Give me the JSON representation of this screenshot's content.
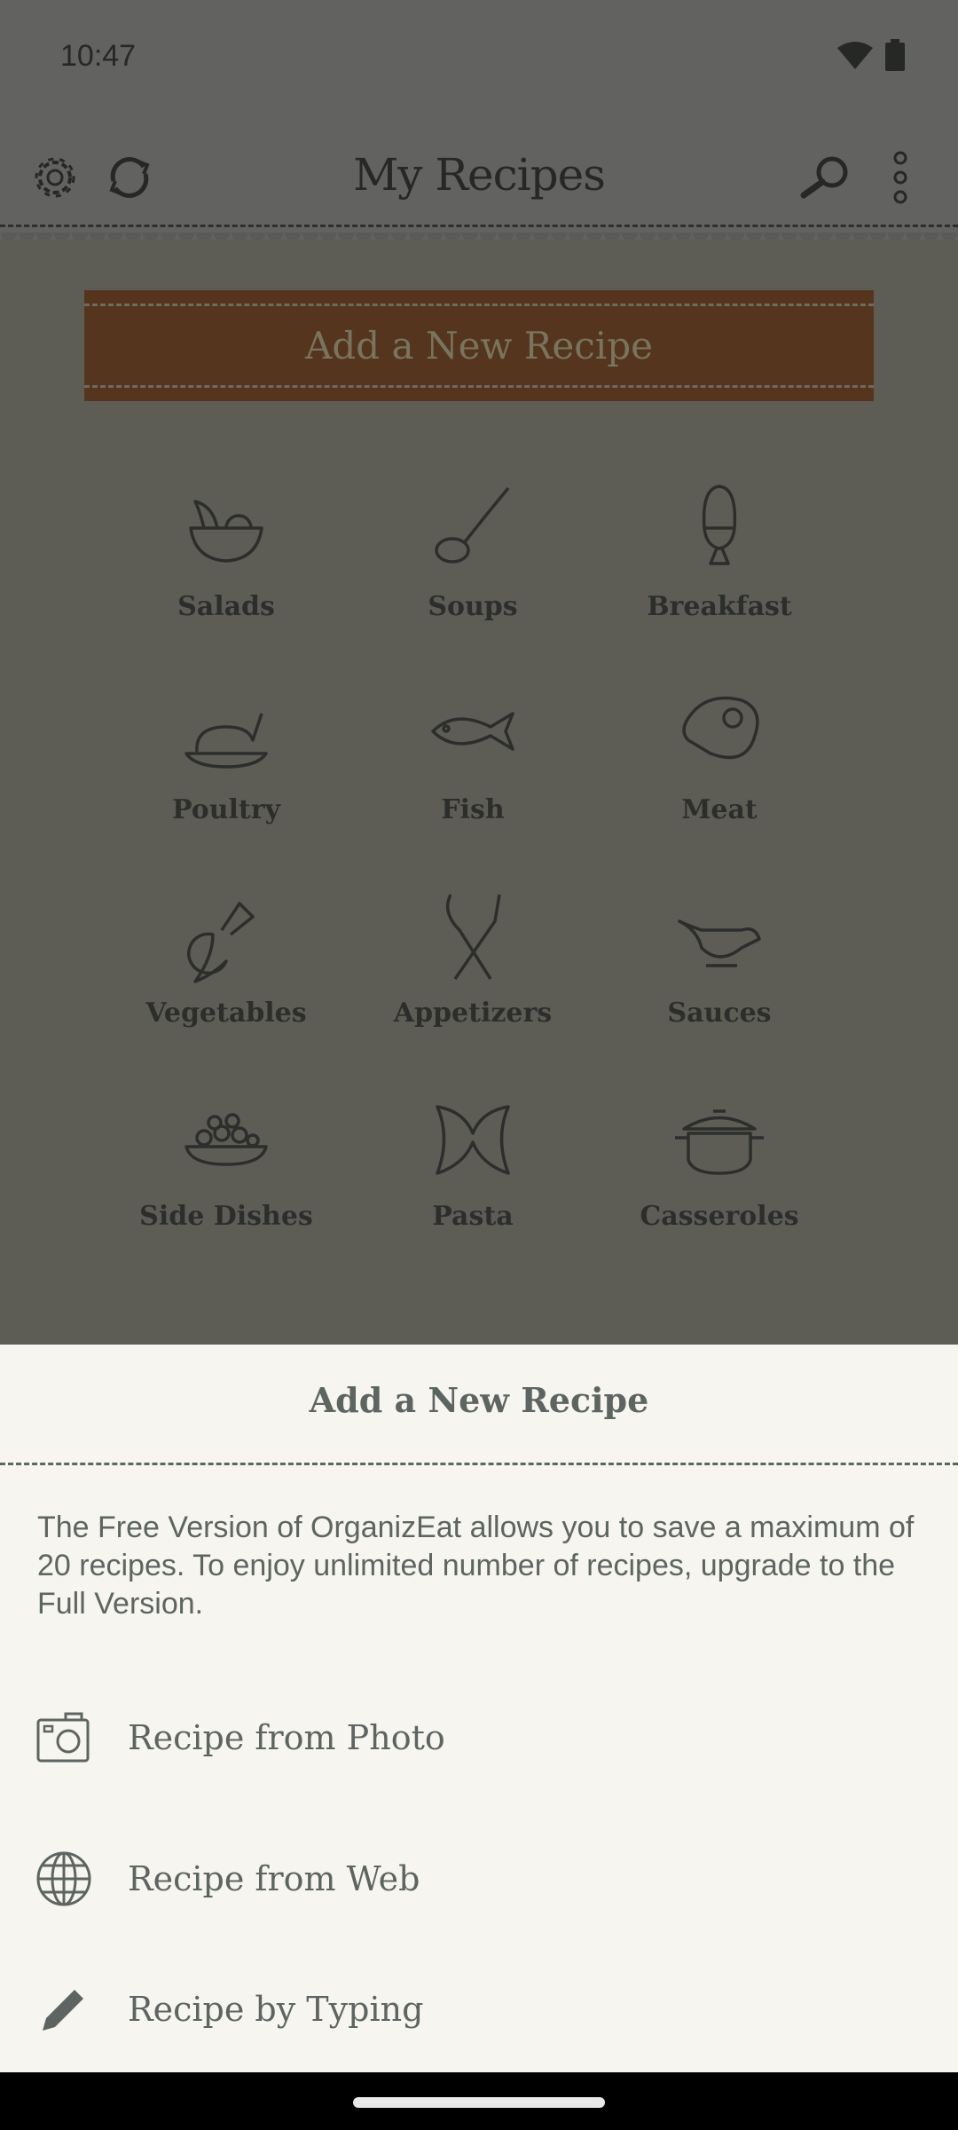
{
  "status_bar": {
    "time": "10:47",
    "icons": [
      "wifi-icon",
      "battery-icon"
    ]
  },
  "toolbar": {
    "title": "My Recipes",
    "left_icons": [
      "gear-icon",
      "sync-icon"
    ],
    "right_icons": [
      "search-icon",
      "more-vert-icon"
    ]
  },
  "add_button": {
    "label": "Add a New Recipe"
  },
  "categories": [
    {
      "label": "Salads",
      "icon": "salad-bowl-icon"
    },
    {
      "label": "Soups",
      "icon": "ladle-icon"
    },
    {
      "label": "Breakfast",
      "icon": "egg-cup-icon"
    },
    {
      "label": "Poultry",
      "icon": "roast-chicken-icon"
    },
    {
      "label": "Fish",
      "icon": "fish-icon"
    },
    {
      "label": "Meat",
      "icon": "steak-icon"
    },
    {
      "label": "Vegetables",
      "icon": "radish-icon"
    },
    {
      "label": "Appetizers",
      "icon": "spoon-fork-icon"
    },
    {
      "label": "Sauces",
      "icon": "gravy-boat-icon"
    },
    {
      "label": "Side Dishes",
      "icon": "side-dish-icon"
    },
    {
      "label": "Pasta",
      "icon": "farfalle-icon"
    },
    {
      "label": "Casseroles",
      "icon": "casserole-icon"
    }
  ],
  "sheet": {
    "title": "Add a New Recipe",
    "message": "The Free Version of OrganizEat allows you to save a maximum of 20 recipes. To enjoy unlimited number of recipes, upgrade to the Full Version.",
    "options": [
      {
        "label": "Recipe from Photo",
        "icon": "camera-icon"
      },
      {
        "label": "Recipe from Web",
        "icon": "globe-icon"
      },
      {
        "label": "Recipe by Typing",
        "icon": "pencil-icon"
      }
    ]
  },
  "colors": {
    "accent": "#56351f",
    "sheet_bg": "#f7f5ef",
    "sheet_text": "#5d6562"
  }
}
